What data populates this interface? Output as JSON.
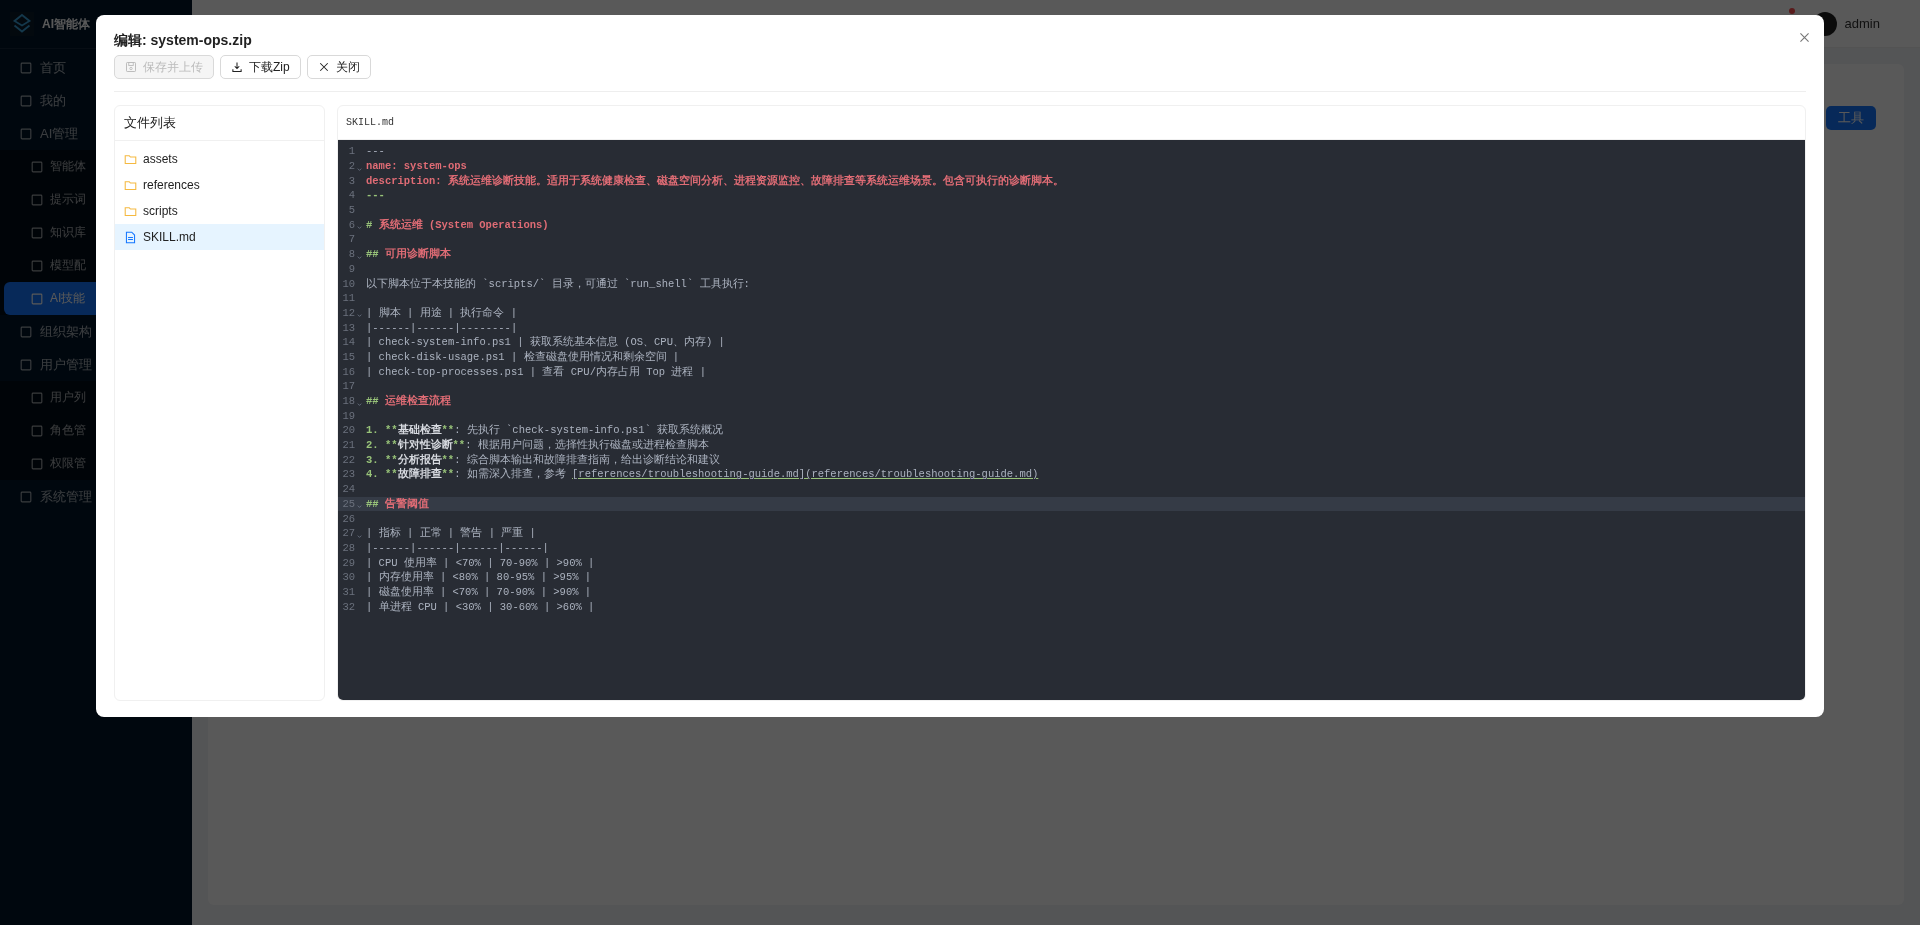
{
  "app": {
    "title": "AI智能体"
  },
  "sidebar": {
    "items": [
      {
        "label": "首页",
        "selected": false
      },
      {
        "label": "我的",
        "selected": false
      },
      {
        "label": "AI管理",
        "selected": false,
        "children": [
          {
            "label": "智能体",
            "selected": false
          },
          {
            "label": "提示词",
            "selected": false
          },
          {
            "label": "知识库",
            "selected": false
          },
          {
            "label": "模型配",
            "selected": false
          },
          {
            "label": "AI技能",
            "selected": true
          }
        ]
      },
      {
        "label": "组织架构",
        "selected": false
      },
      {
        "label": "用户管理",
        "selected": false,
        "children": [
          {
            "label": "用户列",
            "selected": false
          },
          {
            "label": "角色管",
            "selected": false
          },
          {
            "label": "权限管",
            "selected": false
          }
        ]
      },
      {
        "label": "系统管理",
        "selected": false
      }
    ]
  },
  "header": {
    "user": "admin"
  },
  "page": {
    "action_button": "工具"
  },
  "dialog": {
    "title": "编辑: system-ops.zip",
    "buttons": [
      {
        "label": "保存并上传",
        "kind": "save",
        "disabled": true
      },
      {
        "label": "下载Zip",
        "kind": "download",
        "disabled": false
      },
      {
        "label": "关闭",
        "kind": "close",
        "disabled": false
      }
    ],
    "file_list": {
      "title": "文件列表",
      "items": [
        {
          "name": "assets",
          "kind": "folder",
          "selected": false
        },
        {
          "name": "references",
          "kind": "folder",
          "selected": false
        },
        {
          "name": "scripts",
          "kind": "folder",
          "selected": false
        },
        {
          "name": "SKILL.md",
          "kind": "file",
          "selected": true
        }
      ]
    },
    "editor": {
      "filename": "SKILL.md",
      "lines": [
        {
          "no": "1",
          "fold": false,
          "active": false,
          "segs": [
            {
              "text": "---",
              "kind": "dim"
            }
          ]
        },
        {
          "no": "2",
          "fold": true,
          "active": false,
          "segs": [
            {
              "text": "name: system-ops",
              "kind": "meta"
            }
          ]
        },
        {
          "no": "3",
          "fold": false,
          "active": false,
          "segs": [
            {
              "text": "description: 系统运维诊断技能。适用于系统健康检查、磁盘空间分析、进程资源监控、故障排查等系统运维场景。包含可执行的诊断脚本。",
              "kind": "meta"
            }
          ]
        },
        {
          "no": "4",
          "fold": false,
          "active": false,
          "segs": [
            {
              "text": "---",
              "kind": "mark"
            }
          ]
        },
        {
          "no": "5",
          "fold": false,
          "active": false
        },
        {
          "no": "6",
          "fold": true,
          "active": false,
          "segs": [
            {
              "text": "# ",
              "kind": "mark"
            },
            {
              "text": "系统运维 (System Operations)",
              "kind": "head"
            }
          ]
        },
        {
          "no": "7",
          "fold": false,
          "active": false
        },
        {
          "no": "8",
          "fold": true,
          "active": false,
          "segs": [
            {
              "text": "## ",
              "kind": "mark"
            },
            {
              "text": "可用诊断脚本",
              "kind": "head"
            }
          ]
        },
        {
          "no": "9",
          "fold": false,
          "active": false
        },
        {
          "no": "10",
          "fold": false,
          "active": false,
          "segs": [
            {
              "text": "以下脚本位于本技能的 `scripts/` 目录，可通过 `run_shell` 工具执行:",
              "kind": "plain"
            }
          ]
        },
        {
          "no": "11",
          "fold": false,
          "active": false
        },
        {
          "no": "12",
          "fold": true,
          "active": false,
          "segs": [
            {
              "text": "| 脚本 | 用途 | 执行命令 |",
              "kind": "plain"
            }
          ]
        },
        {
          "no": "13",
          "fold": false,
          "active": false,
          "segs": [
            {
              "text": "|------|------|--------|",
              "kind": "plain"
            }
          ]
        },
        {
          "no": "14",
          "fold": false,
          "active": false,
          "segs": [
            {
              "text": "| check-system-info.ps1 | 获取系统基本信息 (OS、CPU、内存) |",
              "kind": "plain"
            }
          ]
        },
        {
          "no": "15",
          "fold": false,
          "active": false,
          "segs": [
            {
              "text": "| check-disk-usage.ps1 | 检查磁盘使用情况和剩余空间 |",
              "kind": "plain"
            }
          ]
        },
        {
          "no": "16",
          "fold": false,
          "active": false,
          "segs": [
            {
              "text": "| check-top-processes.ps1 | 查看 CPU/内存占用 Top 进程 |",
              "kind": "plain"
            }
          ]
        },
        {
          "no": "17",
          "fold": false,
          "active": false
        },
        {
          "no": "18",
          "fold": true,
          "active": false,
          "segs": [
            {
              "text": "## ",
              "kind": "mark"
            },
            {
              "text": "运维检查流程",
              "kind": "head"
            }
          ]
        },
        {
          "no": "19",
          "fold": false,
          "active": false
        },
        {
          "no": "20",
          "fold": false,
          "active": false,
          "segs": [
            {
              "text": "1. **",
              "kind": "mark"
            },
            {
              "text": "基础检查",
              "kind": "strong"
            },
            {
              "text": "**",
              "kind": "mark"
            },
            {
              "text": ": 先执行 `check-system-info.ps1` 获取系统概况",
              "kind": "plain"
            }
          ]
        },
        {
          "no": "21",
          "fold": false,
          "active": false,
          "segs": [
            {
              "text": "2. **",
              "kind": "mark"
            },
            {
              "text": "针对性诊断",
              "kind": "strong"
            },
            {
              "text": "**",
              "kind": "mark"
            },
            {
              "text": ": 根据用户问题，选择性执行磁盘或进程检查脚本",
              "kind": "plain"
            }
          ]
        },
        {
          "no": "22",
          "fold": false,
          "active": false,
          "segs": [
            {
              "text": "3. **",
              "kind": "mark"
            },
            {
              "text": "分析报告",
              "kind": "strong"
            },
            {
              "text": "**",
              "kind": "mark"
            },
            {
              "text": ": 综合脚本输出和故障排查指南，给出诊断结论和建议",
              "kind": "plain"
            }
          ]
        },
        {
          "no": "23",
          "fold": false,
          "active": false,
          "segs": [
            {
              "text": "4. **",
              "kind": "mark"
            },
            {
              "text": "故障排查",
              "kind": "strong"
            },
            {
              "text": "**",
              "kind": "mark"
            },
            {
              "text": ": 如需深入排查，参考 ",
              "kind": "plain"
            },
            {
              "text": "[references/troubleshooting-guide.md](references/troubleshooting-guide.md)",
              "kind": "link"
            }
          ]
        },
        {
          "no": "24",
          "fold": false,
          "active": false
        },
        {
          "no": "25",
          "fold": true,
          "active": true,
          "segs": [
            {
              "text": "## ",
              "kind": "mark"
            },
            {
              "text": "告警阈值",
              "kind": "head"
            }
          ]
        },
        {
          "no": "26",
          "fold": false,
          "active": false
        },
        {
          "no": "27",
          "fold": true,
          "active": false,
          "segs": [
            {
              "text": "| 指标 | 正常 | 警告 | 严重 |",
              "kind": "plain"
            }
          ]
        },
        {
          "no": "28",
          "fold": false,
          "active": false,
          "segs": [
            {
              "text": "|------|------|------|------|",
              "kind": "plain"
            }
          ]
        },
        {
          "no": "29",
          "fold": false,
          "active": false,
          "segs": [
            {
              "text": "| CPU 使用率 | <70% | 70-90% | >90% |",
              "kind": "plain"
            }
          ]
        },
        {
          "no": "30",
          "fold": false,
          "active": false,
          "segs": [
            {
              "text": "| 内存使用率 | <80% | 80-95% | >95% |",
              "kind": "plain"
            }
          ]
        },
        {
          "no": "31",
          "fold": false,
          "active": false,
          "segs": [
            {
              "text": "| 磁盘使用率 | <70% | 70-90% | >90% |",
              "kind": "plain"
            }
          ]
        },
        {
          "no": "32",
          "fold": false,
          "active": false,
          "segs": [
            {
              "text": "| 单进程 CPU | <30% | 30-60% | >60% |",
              "kind": "plain"
            }
          ]
        }
      ]
    }
  }
}
